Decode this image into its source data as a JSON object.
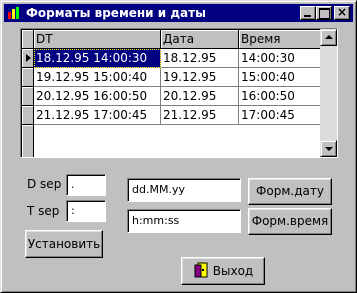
{
  "window": {
    "title": "Форматы времени и даты",
    "minimize_label": "_",
    "maximize_label": "□",
    "close_label": "×"
  },
  "grid": {
    "columns": [
      "DT",
      "Дата",
      "Время"
    ],
    "rows": [
      {
        "dt": "18.12.95 14:00:30",
        "date": "18.12.95",
        "time": "14:00:30",
        "current": true
      },
      {
        "dt": "19.12.95 15:00:40",
        "date": "19.12.95",
        "time": "15:00:40",
        "current": false
      },
      {
        "dt": "20.12.95 16:00:50",
        "date": "20.12.95",
        "time": "16:00:50",
        "current": false
      },
      {
        "dt": "21.12.95 17:00:45",
        "date": "21.12.95",
        "time": "17:00:45",
        "current": false
      }
    ]
  },
  "separators": {
    "date_label": "D sep",
    "date_value": ".",
    "time_label": "T sep",
    "time_value": ":"
  },
  "formats": {
    "date_format": "dd.MM.yy",
    "time_format": "h:mm:ss"
  },
  "buttons": {
    "set": "Установить",
    "format_date": "Форм.дату",
    "format_time": "Форм.время",
    "exit": "Выход"
  },
  "colors": {
    "title_bar": "#000080",
    "selection": "#000080",
    "face": "#c0c0c0"
  }
}
